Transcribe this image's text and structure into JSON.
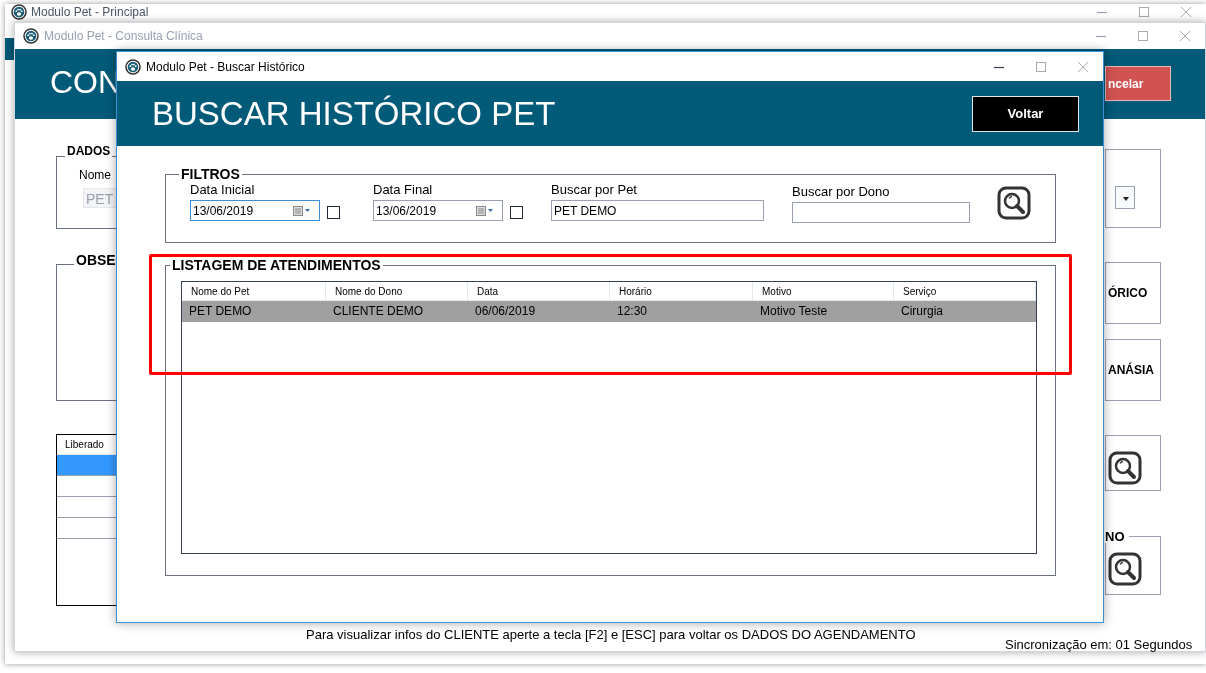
{
  "main_window": {
    "title": "Modulo Pet - Principal"
  },
  "consulta_window": {
    "title": "Modulo Pet - Consulta Clínica",
    "header_title": "CON",
    "cancel_button": "ncelar",
    "dados_label": "DADOS",
    "nome_label": "Nome",
    "nome_value": "PET",
    "obse_label": "OBSE",
    "grid_column": "Liberado",
    "grid_rows": [
      {
        "selected": true
      },
      {
        "selected": false
      },
      {
        "selected": false
      },
      {
        "selected": false
      }
    ],
    "side_buttons": [
      "ÓRICO",
      "ANÁSIA"
    ],
    "search_group_label": "NO",
    "hint": "Para visualizar infos do CLIENTE aperte a tecla [F2] e [ESC] para voltar os DADOS DO AGENDAMENTO",
    "sync_status": "Sincronização em: 01 Segundos"
  },
  "dialog": {
    "title": "Modulo Pet - Buscar Histórico",
    "header_title": "BUSCAR HISTÓRICO PET",
    "back_button": "Voltar",
    "filters": {
      "legend": "FILTROS",
      "fields": [
        {
          "kind": "date",
          "label": "Data Inicial",
          "value": "13/06/2019",
          "checked": false,
          "focused": true
        },
        {
          "kind": "date",
          "label": "Data Final",
          "value": "13/06/2019",
          "checked": false,
          "focused": false
        },
        {
          "kind": "text",
          "label": "Buscar por Pet",
          "value": "PET DEMO"
        },
        {
          "kind": "text",
          "label": "Buscar por Dono"
        }
      ]
    },
    "listing": {
      "legend": "LISTAGEM DE ATENDIMENTOS",
      "columns": [
        "Nome do Pet",
        "Nome do Dono",
        "Data",
        "Horário",
        "Motivo",
        "Serviço"
      ],
      "rows": [
        {
          "cells": [
            "PET DEMO",
            "CLIENTE DEMO",
            "06/06/2019",
            "12:30",
            "Motivo Teste",
            "Cirurgia"
          ],
          "selected": true
        }
      ]
    }
  }
}
